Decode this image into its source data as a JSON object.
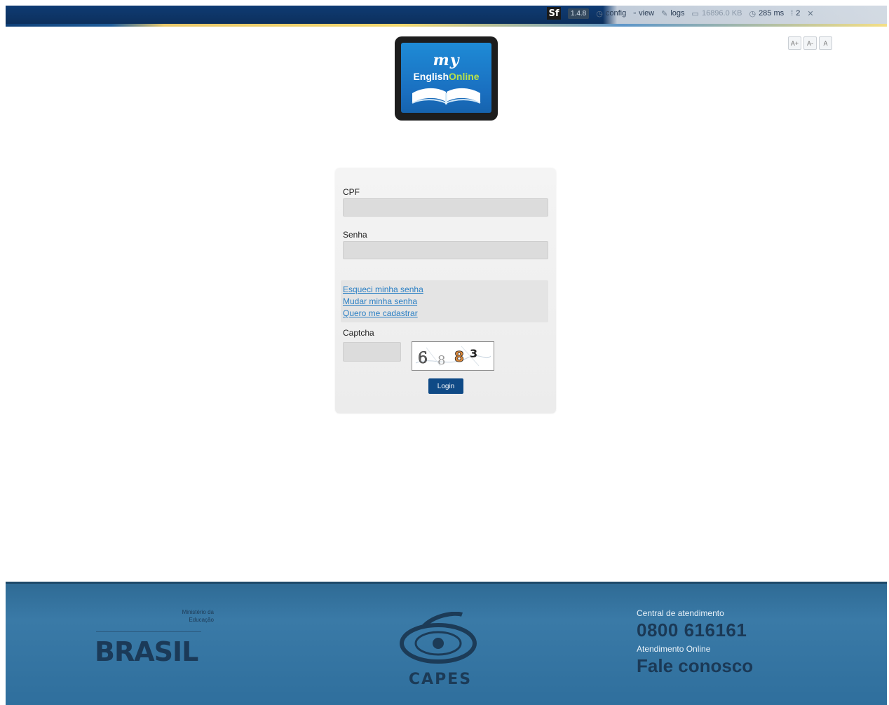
{
  "toolbar": {
    "sf_logo": "Sf",
    "version": "1.4.8",
    "config": "config",
    "view": "view",
    "logs": "logs",
    "memory": "16896.0 KB",
    "time": "285 ms",
    "queries": "2"
  },
  "font_buttons": [
    "A+",
    "A-",
    "A"
  ],
  "logo": {
    "my": "my",
    "english": "English",
    "online": "Online"
  },
  "form": {
    "cpf_label": "CPF",
    "cpf_value": "",
    "senha_label": "Senha",
    "senha_value": "",
    "links": {
      "forgot": "Esqueci minha senha",
      "change": "Mudar minha senha",
      "register": "Quero me cadastrar"
    },
    "captcha_label": "Captcha",
    "captcha_value": "",
    "captcha_text": "6 8 8 3",
    "login_label": "Login"
  },
  "footer": {
    "ministerio": "Ministério da",
    "educacao": "Educação",
    "brasil": "BRASIL",
    "capes": "CAPES",
    "central_label": "Central de atendimento",
    "phone": "0800 616161",
    "online_label": "Atendimento Online",
    "fale": "Fale conosco"
  },
  "colors": {
    "top_band": "#0f3b73",
    "footer": "#3a7aa7",
    "login_button": "#0f4a86",
    "link": "#2a7fc4"
  }
}
